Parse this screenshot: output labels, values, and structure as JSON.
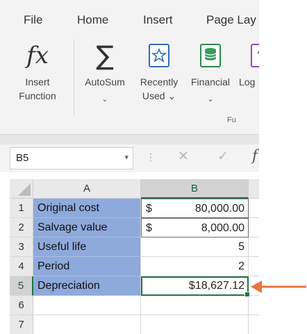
{
  "menu": {
    "items": [
      "File",
      "Home",
      "Insert",
      "Page Lay"
    ]
  },
  "ribbon": {
    "buttons": [
      {
        "label1": "Insert",
        "label2": "Function",
        "icon": "fx-icon",
        "glyph": "fx"
      },
      {
        "label1": "AutoSum",
        "chevron": "⌄",
        "icon": "sigma-icon",
        "glyph": "∑"
      },
      {
        "label1": "Recently",
        "label2": "Used ⌄",
        "icon": "star-book-icon"
      },
      {
        "label1": "Financial",
        "chevron": "⌄",
        "icon": "money-stack-icon"
      },
      {
        "label1": "Log",
        "icon": "question-book-icon"
      }
    ],
    "group_caption": "Fu"
  },
  "formula_bar": {
    "namebox": "B5",
    "namebox_caret": "▾",
    "dots": "⋮",
    "cancel": "✕",
    "enter": "✓",
    "fx": "f"
  },
  "grid": {
    "columns": [
      "A",
      "B"
    ],
    "active_cell": "B5",
    "rows": [
      {
        "num": "1",
        "a": "Original cost",
        "b_currency": "$",
        "b_value": "80,000.00"
      },
      {
        "num": "2",
        "a": "Salvage value",
        "b_currency": "$",
        "b_value": "8,000.00"
      },
      {
        "num": "3",
        "a": "Useful life",
        "b_currency": "",
        "b_value": "5"
      },
      {
        "num": "4",
        "a": "Period",
        "b_currency": "",
        "b_value": "2"
      },
      {
        "num": "5",
        "a": "Depreciation",
        "b_currency": "",
        "b_value": "$18,627.12"
      },
      {
        "num": "6",
        "a": "",
        "b_currency": "",
        "b_value": ""
      },
      {
        "num": "7",
        "a": "",
        "b_currency": "",
        "b_value": ""
      }
    ]
  },
  "colors": {
    "highlight": "#8ea9db",
    "excel_green": "#217346",
    "arrow": "#e8743b"
  }
}
